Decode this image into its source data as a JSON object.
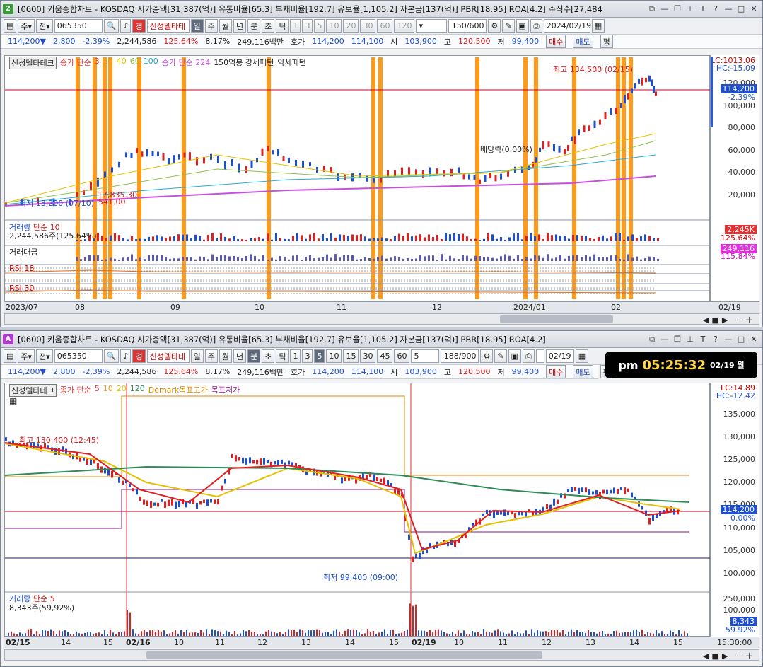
{
  "top": {
    "badge": "2",
    "title": "[0600] 키움종합차트 - KOSDAQ 시가총액[31,387(억)] 유통비율[65.3] 부채비율[192.7] 유보율[1,105.2] 자본금[137(억)] PBR[18.95] ROA[4.2] 주식수[27,484",
    "code": "065350",
    "period_buttons": [
      "일",
      "주",
      "월",
      "년",
      "분",
      "초",
      "틱"
    ],
    "nums": [
      "1",
      "3",
      "5",
      "10",
      "20",
      "30",
      "60",
      "120"
    ],
    "count": "150/600",
    "date": "2024/02/19",
    "name": "신성델타테",
    "price": "114,200",
    "arrow": "▼",
    "change": "2,800",
    "pct": "-2.39%",
    "volume": "2,244,586",
    "vol_pct": "125.64%",
    "turn": "8.17%",
    "amount": "249,116백만",
    "ask_label": "호가",
    "ask": "114,200",
    "bid": "114,100",
    "open_label": "시",
    "open": "103,900",
    "high_label": "고",
    "high": "120,500",
    "low_label": "저",
    "low": "99,400",
    "buy": "매수",
    "sell": "매도",
    "peg": "평",
    "legend": {
      "name": "신성델타테크",
      "ma_title": "종가 단순",
      "ma_periods": [
        "3",
        "15",
        "40",
        "60",
        "100"
      ],
      "ma2": "종가 단순 224",
      "pattern": "150억봉 강세패턴",
      "pattern2": "약세패턴"
    },
    "annot": {
      "high": "최고 134,500 (02/15)",
      "low": "최저 13,200 (07/10)",
      "div": "배당락(0.00%)",
      "mid": "17,835.30",
      "mid2": "541.00"
    },
    "yaxis": [
      "120,000",
      "100,000",
      "80,000",
      "60,000",
      "40,000",
      "20,000"
    ],
    "lc": "LC:1013.06",
    "hc": "HC:-15.09",
    "last": "114,200",
    "last_pct": "-2.39%",
    "vol_legend": "거래량",
    "vol_ma": "단순 10",
    "vol_text": "2,244,586주(125.64%)",
    "vol_tag": "2,245K",
    "vol_tag_pct": "125.64%",
    "amt_legend": "거래대금",
    "amt_tag": "249,116",
    "amt_tag_pct": "115.84%",
    "rsi1": "RSI 18",
    "rsi2": "RSI 30",
    "xlabels": [
      "2023/07",
      "08",
      "09",
      "10",
      "11",
      "12",
      "2024/01",
      "02",
      "02/19"
    ]
  },
  "bottom": {
    "badge": "A",
    "title": "[0600] 키움종합차트 - KOSDAQ 시가총액[31,387(억)] 유통비율[65.3] 부채비율[192.7] 유보율[1,105.2] 자본금[137(억)] PBR[18.95] ROA[4.2]",
    "code": "065350",
    "nums": [
      "1",
      "3",
      "5",
      "10",
      "15",
      "30",
      "45",
      "60"
    ],
    "minute": "5",
    "count": "188/900",
    "date": "02/19",
    "legend": {
      "name": "신성델타테크",
      "ma_title": "종가 단순",
      "ma_periods": [
        "5",
        "10",
        "20",
        "120"
      ],
      "demark": "Demark목표고가",
      "demark2": "목표저가"
    },
    "annot": {
      "high": "최고 130,400 (12:45)",
      "low": "최저 99,400 (09:00)"
    },
    "yaxis": [
      "135,000",
      "130,000",
      "125,000",
      "120,000",
      "115,000",
      "110,000",
      "105,000",
      "100,000"
    ],
    "lc": "LC:14.89",
    "hc": "HC:-12.42",
    "last": "114,200",
    "last_pct": "0.00%",
    "vol_legend": "거래량",
    "vol_ma": "단순 5",
    "vol_text": "8,343주(59,92%)",
    "vol_axis": "250,000",
    "vol_axis2": "100,000",
    "vol_tag": "8,343",
    "vol_tag_pct": "59.92%",
    "xlabels": [
      "02/15",
      "14",
      "15",
      "02/16",
      "10",
      "11",
      "12",
      "13",
      "14",
      "15",
      "02/19",
      "10",
      "11",
      "12",
      "13",
      "14",
      "15"
    ],
    "xtime": "15:30:00"
  },
  "clock": {
    "ampm": "pm",
    "time": "05:25:32",
    "date": "02/19 월"
  }
}
